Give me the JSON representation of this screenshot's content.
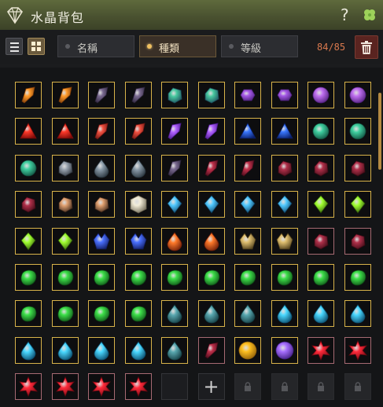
{
  "window": {
    "title": "水晶背包"
  },
  "header": {
    "help_icon": "question-mark-icon",
    "extra_icon": "clover-icon",
    "logo_icon": "diamond-icon"
  },
  "toolbar": {
    "view_list_icon": "list-view-icon",
    "view_grid_icon": "grid-view-icon",
    "sort_tabs": [
      {
        "label": "名稱",
        "active": false
      },
      {
        "label": "種類",
        "active": true
      },
      {
        "label": "等級",
        "active": false
      }
    ],
    "capacity": "84/85",
    "trash_icon": "trash-icon"
  },
  "colors": {
    "header": "#4a5230",
    "accent": "#d9794e",
    "active_tab": "#f0c060"
  },
  "inventory": {
    "rows": [
      [
        [
          "amber-shard",
          "y"
        ],
        [
          "amber-shard",
          "y"
        ],
        [
          "dark-shard",
          "y"
        ],
        [
          "dark-shard",
          "y"
        ],
        [
          "teal-chunk",
          "y"
        ],
        [
          "teal-chunk",
          "y"
        ],
        [
          "purple-hex",
          "y"
        ],
        [
          "purple-hex",
          "y"
        ],
        [
          "purple-round",
          "y"
        ],
        [
          "purple-round",
          "y"
        ]
      ],
      [
        [
          "red-tri",
          "y"
        ],
        [
          "red-tri",
          "y"
        ],
        [
          "red-shard",
          "y"
        ],
        [
          "red-shard",
          "y"
        ],
        [
          "violet-shard",
          "y"
        ],
        [
          "violet-shard",
          "y"
        ],
        [
          "blue-tri",
          "y"
        ],
        [
          "blue-tri",
          "y"
        ],
        [
          "green-round",
          "y"
        ],
        [
          "green-round",
          "y"
        ]
      ],
      [
        [
          "green-round",
          "y"
        ],
        [
          "gray-chunk",
          "y"
        ],
        [
          "gray-drop",
          "y"
        ],
        [
          "gray-drop",
          "y"
        ],
        [
          "dark-shard",
          "y"
        ],
        [
          "maroon-shard",
          "y"
        ],
        [
          "maroon-shard",
          "y"
        ],
        [
          "maroon-chunk",
          "y"
        ],
        [
          "maroon-chunk",
          "y"
        ],
        [
          "maroon-chunk",
          "y"
        ]
      ],
      [
        [
          "maroon-chunk",
          "y"
        ],
        [
          "smoky-chunk",
          "y"
        ],
        [
          "smoky-chunk",
          "y"
        ],
        [
          "cube-white",
          "y"
        ],
        [
          "cyan-spike",
          "y"
        ],
        [
          "cyan-spike",
          "y"
        ],
        [
          "cyan-spike",
          "y"
        ],
        [
          "cyan-spike",
          "y"
        ],
        [
          "lime-spike",
          "y"
        ],
        [
          "lime-spike",
          "y"
        ]
      ],
      [
        [
          "lime-spike",
          "y"
        ],
        [
          "lime-spike",
          "y"
        ],
        [
          "blue-cluster",
          "y"
        ],
        [
          "blue-cluster",
          "y"
        ],
        [
          "orange-drop",
          "y"
        ],
        [
          "orange-drop",
          "y"
        ],
        [
          "bronze-cluster",
          "y"
        ],
        [
          "bronze-cluster",
          "y"
        ],
        [
          "maroon-chunk",
          "p"
        ],
        [
          "maroon-chunk",
          "p"
        ]
      ],
      [
        [
          "green-blob",
          "y"
        ],
        [
          "green-blob",
          "y"
        ],
        [
          "green-blob",
          "y"
        ],
        [
          "green-blob",
          "y"
        ],
        [
          "green-blob",
          "y"
        ],
        [
          "green-blob",
          "y"
        ],
        [
          "green-blob",
          "y"
        ],
        [
          "green-blob",
          "y"
        ],
        [
          "green-blob",
          "y"
        ],
        [
          "green-blob",
          "y"
        ]
      ],
      [
        [
          "green-blob",
          "y"
        ],
        [
          "green-blob",
          "y"
        ],
        [
          "green-blob",
          "y"
        ],
        [
          "green-blob",
          "y"
        ],
        [
          "teal-drop",
          "y"
        ],
        [
          "teal-drop",
          "y"
        ],
        [
          "teal-drop",
          "y"
        ],
        [
          "ice-drop",
          "y"
        ],
        [
          "ice-drop",
          "y"
        ],
        [
          "ice-drop",
          "y"
        ]
      ],
      [
        [
          "ice-drop",
          "y"
        ],
        [
          "ice-drop",
          "y"
        ],
        [
          "ice-drop",
          "y"
        ],
        [
          "ice-drop",
          "y"
        ],
        [
          "teal-drop",
          "y"
        ],
        [
          "maroon-shard",
          "p"
        ],
        [
          "gold-orb",
          "y"
        ],
        [
          "purple-orb",
          "y"
        ],
        [
          "red-star",
          "p"
        ],
        [
          "red-star",
          "p"
        ]
      ],
      [
        [
          "red-star",
          "p"
        ],
        [
          "red-star",
          "p"
        ],
        [
          "red-star",
          "p"
        ],
        [
          "red-star",
          "p"
        ],
        [
          "empty",
          "e"
        ],
        [
          "add",
          "e"
        ],
        [
          "locked",
          "l"
        ],
        [
          "locked",
          "l"
        ],
        [
          "locked",
          "l"
        ],
        [
          "locked",
          "l"
        ]
      ]
    ]
  }
}
